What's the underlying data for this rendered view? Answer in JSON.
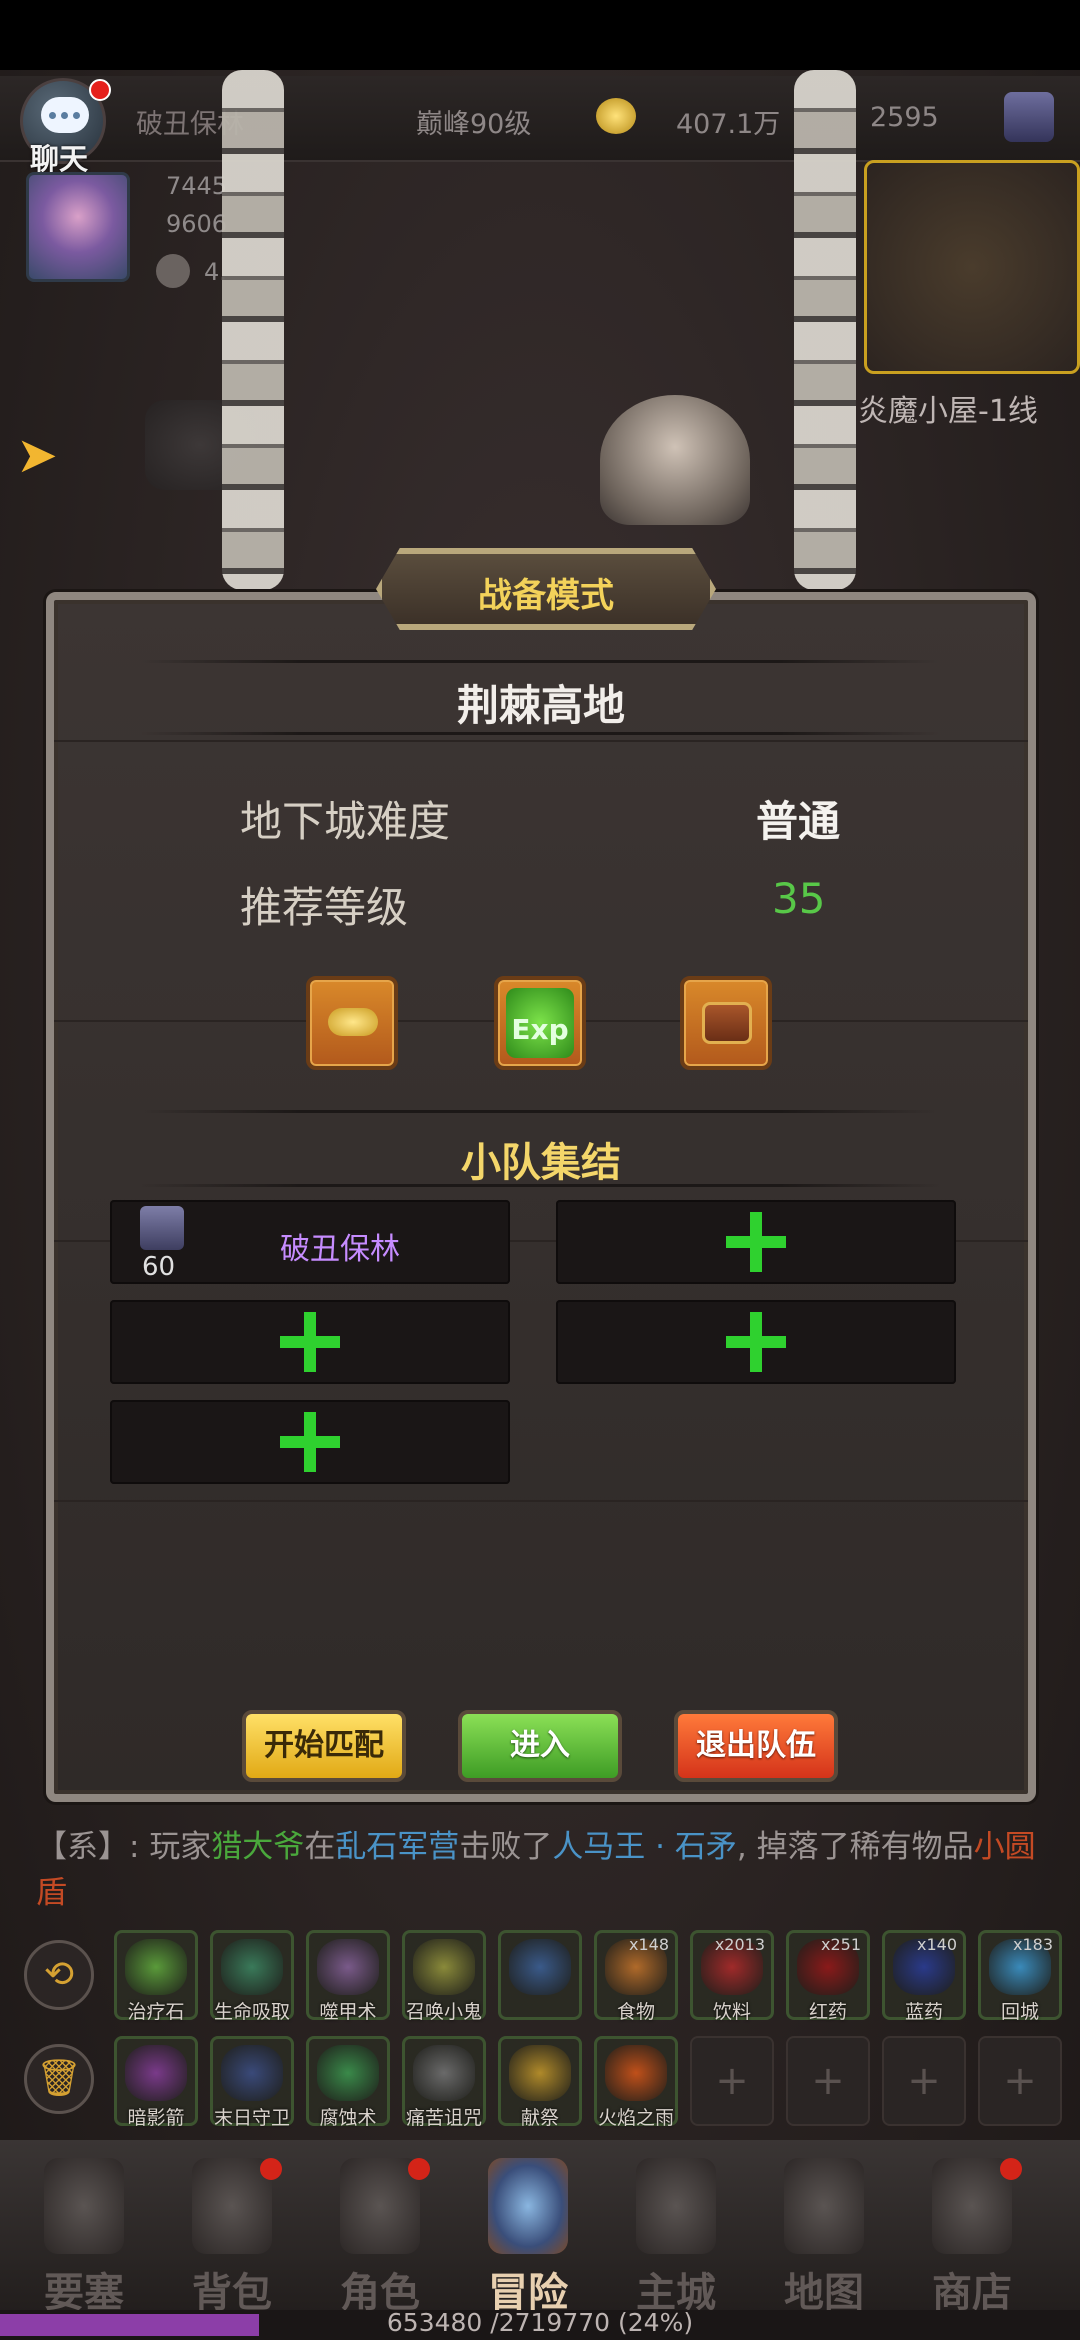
{
  "top_bar": {
    "chat_label": "聊天",
    "player_name": "破丑保林",
    "rank_level": "巅峰90级",
    "gold": "407.1万",
    "gems": "2595"
  },
  "stats": {
    "hp": "7445",
    "mp": "9606",
    "power": "4."
  },
  "minimap": {
    "label": "炎魔小屋-1线"
  },
  "panel": {
    "mode_title": "战备模式",
    "stage_name": "荆棘高地",
    "difficulty_label": "地下城难度",
    "difficulty_value": "普通",
    "level_label": "推荐等级",
    "level_value": "35",
    "reward_exp_text": "Exp",
    "squad_title": "小队集结",
    "members": [
      {
        "name": "破丑保林",
        "level": "60"
      }
    ],
    "buttons": {
      "match": "开始匹配",
      "enter": "进入",
      "leave": "退出队伍"
    }
  },
  "message": {
    "prefix": "【系】:",
    "t1": "玩家",
    "player": "猎大爷",
    "t2": "在",
    "place": "乱石军营",
    "t3": "击败了",
    "boss": "人马王 · 石矛",
    "t4": ", 掉落了稀有物品",
    "item": "小圆盾"
  },
  "skills_row1": [
    {
      "name": "治疗石",
      "count": ""
    },
    {
      "name": "生命吸取",
      "count": ""
    },
    {
      "name": "噬甲术",
      "count": ""
    },
    {
      "name": "召唤小鬼",
      "count": ""
    },
    {
      "name": "",
      "count": ""
    },
    {
      "name": "食物",
      "count": "x148"
    },
    {
      "name": "饮料",
      "count": "x2013"
    },
    {
      "name": "红药",
      "count": "x251"
    },
    {
      "name": "蓝药",
      "count": "x140"
    },
    {
      "name": "回城",
      "count": "x183"
    }
  ],
  "skills_row2": [
    {
      "name": "暗影箭",
      "count": ""
    },
    {
      "name": "末日守卫",
      "count": ""
    },
    {
      "name": "腐蚀术",
      "count": ""
    },
    {
      "name": "痛苦诅咒",
      "count": ""
    },
    {
      "name": "献祭",
      "count": ""
    },
    {
      "name": "火焰之雨",
      "count": ""
    }
  ],
  "nav": [
    "要塞",
    "背包",
    "角色",
    "冒险",
    "主城",
    "地图",
    "商店"
  ],
  "exp": {
    "text": "653480 /2719770 (24%)",
    "fraction": 0.24
  }
}
